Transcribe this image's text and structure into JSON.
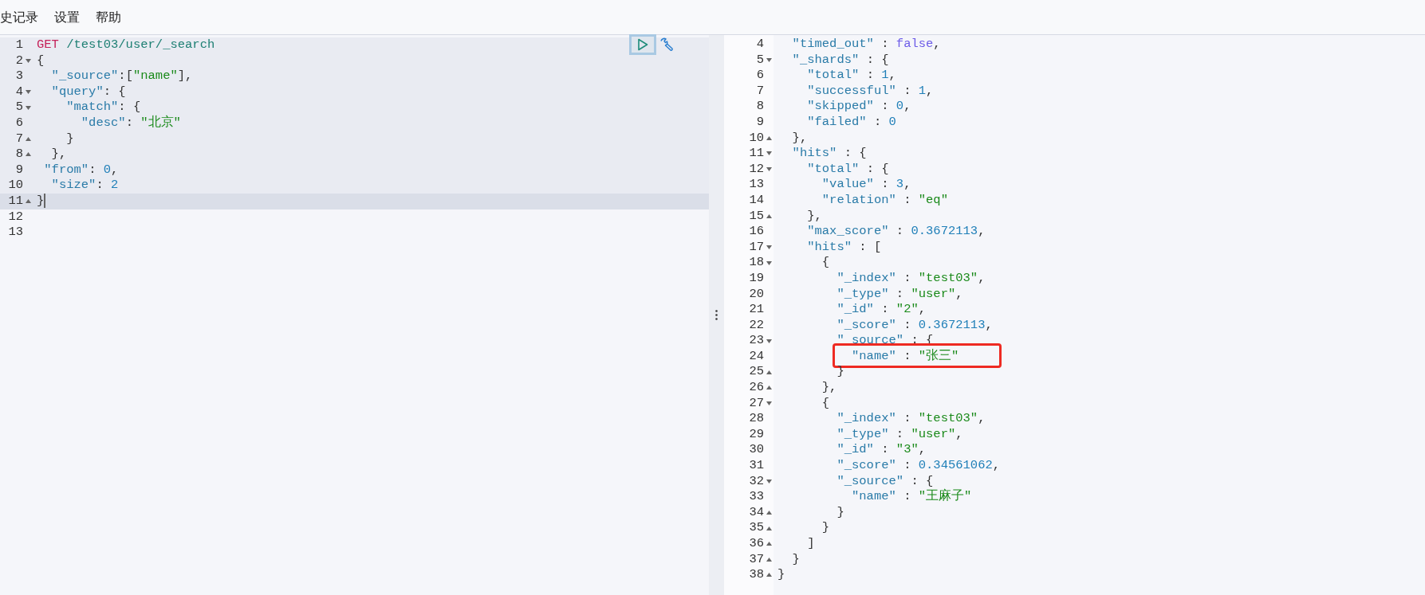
{
  "menu": [
    {
      "label": "史记录"
    },
    {
      "label": "设置"
    },
    {
      "label": "帮助"
    }
  ],
  "request_editor": {
    "lines": [
      {
        "n": "1",
        "kind": "plain",
        "current": false,
        "tokens": [
          {
            "kind": "method",
            "text": "GET"
          },
          {
            "kind": "url",
            "text": " /test03/user/_search"
          }
        ]
      },
      {
        "n": "2",
        "kind": "fold_start",
        "current": false,
        "tokens": [
          {
            "kind": "punct",
            "text": "{"
          }
        ]
      },
      {
        "n": "3",
        "kind": "plain",
        "current": false,
        "tokens": [
          {
            "kind": "key",
            "text": "  \"_source\""
          },
          {
            "kind": "punct",
            "text": ":["
          },
          {
            "kind": "string",
            "text": "\"name\""
          },
          {
            "kind": "punct",
            "text": "],"
          }
        ]
      },
      {
        "n": "4",
        "kind": "fold_start",
        "current": false,
        "tokens": [
          {
            "kind": "key",
            "text": "  \"query\""
          },
          {
            "kind": "punct",
            "text": ": {"
          }
        ]
      },
      {
        "n": "5",
        "kind": "fold_start",
        "current": false,
        "tokens": [
          {
            "kind": "key",
            "text": "    \"match\""
          },
          {
            "kind": "punct",
            "text": ": {"
          }
        ]
      },
      {
        "n": "6",
        "kind": "plain",
        "current": false,
        "tokens": [
          {
            "kind": "key",
            "text": "      \"desc\""
          },
          {
            "kind": "punct",
            "text": ": "
          },
          {
            "kind": "string",
            "text": "\"北京\""
          }
        ]
      },
      {
        "n": "7",
        "kind": "fold_end",
        "current": false,
        "tokens": [
          {
            "kind": "punct",
            "text": "    }"
          }
        ]
      },
      {
        "n": "8",
        "kind": "fold_end",
        "current": false,
        "tokens": [
          {
            "kind": "punct",
            "text": "  },"
          }
        ]
      },
      {
        "n": "9",
        "kind": "plain",
        "current": false,
        "tokens": [
          {
            "kind": "key",
            "text": " \"from\""
          },
          {
            "kind": "punct",
            "text": ": "
          },
          {
            "kind": "number",
            "text": "0"
          },
          {
            "kind": "punct",
            "text": ","
          }
        ]
      },
      {
        "n": "10",
        "kind": "plain",
        "current": false,
        "tokens": [
          {
            "kind": "key",
            "text": "  \"size\""
          },
          {
            "kind": "punct",
            "text": ": "
          },
          {
            "kind": "number",
            "text": "2"
          }
        ]
      },
      {
        "n": "11",
        "kind": "fold_end",
        "current": true,
        "tokens": [
          {
            "kind": "punct",
            "text": "}"
          }
        ]
      },
      {
        "n": "12",
        "kind": "plain",
        "current": false
      },
      {
        "n": "13",
        "kind": "plain",
        "current": false
      }
    ]
  },
  "response_editor": {
    "lines": [
      {
        "n": "4",
        "kind": "plain",
        "annotated": false,
        "tokens": [
          {
            "kind": "key",
            "text": "  \"timed_out\""
          },
          {
            "kind": "punct",
            "text": " : "
          },
          {
            "kind": "boolean",
            "text": "false"
          },
          {
            "kind": "punct",
            "text": ","
          }
        ]
      },
      {
        "n": "5",
        "kind": "fold_start",
        "annotated": false,
        "tokens": [
          {
            "kind": "key",
            "text": "  \"_shards\""
          },
          {
            "kind": "punct",
            "text": " : {"
          }
        ]
      },
      {
        "n": "6",
        "kind": "plain",
        "annotated": false,
        "tokens": [
          {
            "kind": "key",
            "text": "    \"total\""
          },
          {
            "kind": "punct",
            "text": " : "
          },
          {
            "kind": "number",
            "text": "1"
          },
          {
            "kind": "punct",
            "text": ","
          }
        ]
      },
      {
        "n": "7",
        "kind": "plain",
        "annotated": false,
        "tokens": [
          {
            "kind": "key",
            "text": "    \"successful\""
          },
          {
            "kind": "punct",
            "text": " : "
          },
          {
            "kind": "number",
            "text": "1"
          },
          {
            "kind": "punct",
            "text": ","
          }
        ]
      },
      {
        "n": "8",
        "kind": "plain",
        "annotated": false,
        "tokens": [
          {
            "kind": "key",
            "text": "    \"skipped\""
          },
          {
            "kind": "punct",
            "text": " : "
          },
          {
            "kind": "number",
            "text": "0"
          },
          {
            "kind": "punct",
            "text": ","
          }
        ]
      },
      {
        "n": "9",
        "kind": "plain",
        "annotated": false,
        "tokens": [
          {
            "kind": "key",
            "text": "    \"failed\""
          },
          {
            "kind": "punct",
            "text": " : "
          },
          {
            "kind": "number",
            "text": "0"
          }
        ]
      },
      {
        "n": "10",
        "kind": "fold_end",
        "annotated": false,
        "tokens": [
          {
            "kind": "punct",
            "text": "  },"
          }
        ]
      },
      {
        "n": "11",
        "kind": "fold_start",
        "annotated": false,
        "tokens": [
          {
            "kind": "key",
            "text": "  \"hits\""
          },
          {
            "kind": "punct",
            "text": " : {"
          }
        ]
      },
      {
        "n": "12",
        "kind": "fold_start",
        "annotated": false,
        "tokens": [
          {
            "kind": "key",
            "text": "    \"total\""
          },
          {
            "kind": "punct",
            "text": " : {"
          }
        ]
      },
      {
        "n": "13",
        "kind": "plain",
        "annotated": false,
        "tokens": [
          {
            "kind": "key",
            "text": "      \"value\""
          },
          {
            "kind": "punct",
            "text": " : "
          },
          {
            "kind": "number",
            "text": "3"
          },
          {
            "kind": "punct",
            "text": ","
          }
        ]
      },
      {
        "n": "14",
        "kind": "plain",
        "annotated": false,
        "tokens": [
          {
            "kind": "key",
            "text": "      \"relation\""
          },
          {
            "kind": "punct",
            "text": " : "
          },
          {
            "kind": "string",
            "text": "\"eq\""
          }
        ]
      },
      {
        "n": "15",
        "kind": "fold_end",
        "annotated": false,
        "tokens": [
          {
            "kind": "punct",
            "text": "    },"
          }
        ]
      },
      {
        "n": "16",
        "kind": "plain",
        "annotated": false,
        "tokens": [
          {
            "kind": "key",
            "text": "    \"max_score\""
          },
          {
            "kind": "punct",
            "text": " : "
          },
          {
            "kind": "number",
            "text": "0.3672113"
          },
          {
            "kind": "punct",
            "text": ","
          }
        ]
      },
      {
        "n": "17",
        "kind": "fold_start",
        "annotated": false,
        "tokens": [
          {
            "kind": "key",
            "text": "    \"hits\""
          },
          {
            "kind": "punct",
            "text": " : ["
          }
        ]
      },
      {
        "n": "18",
        "kind": "fold_start",
        "annotated": false,
        "tokens": [
          {
            "kind": "punct",
            "text": "      {"
          }
        ]
      },
      {
        "n": "19",
        "kind": "plain",
        "annotated": false,
        "tokens": [
          {
            "kind": "key",
            "text": "        \"_index\""
          },
          {
            "kind": "punct",
            "text": " : "
          },
          {
            "kind": "string",
            "text": "\"test03\""
          },
          {
            "kind": "punct",
            "text": ","
          }
        ]
      },
      {
        "n": "20",
        "kind": "plain",
        "annotated": false,
        "tokens": [
          {
            "kind": "key",
            "text": "        \"_type\""
          },
          {
            "kind": "punct",
            "text": " : "
          },
          {
            "kind": "string",
            "text": "\"user\""
          },
          {
            "kind": "punct",
            "text": ","
          }
        ]
      },
      {
        "n": "21",
        "kind": "plain",
        "annotated": false,
        "tokens": [
          {
            "kind": "key",
            "text": "        \"_id\""
          },
          {
            "kind": "punct",
            "text": " : "
          },
          {
            "kind": "string",
            "text": "\"2\""
          },
          {
            "kind": "punct",
            "text": ","
          }
        ]
      },
      {
        "n": "22",
        "kind": "plain",
        "annotated": false,
        "tokens": [
          {
            "kind": "key",
            "text": "        \"_score\""
          },
          {
            "kind": "punct",
            "text": " : "
          },
          {
            "kind": "number",
            "text": "0.3672113"
          },
          {
            "kind": "punct",
            "text": ","
          }
        ]
      },
      {
        "n": "23",
        "kind": "fold_start",
        "annotated": false,
        "tokens": [
          {
            "kind": "key",
            "text": "        \"_source\""
          },
          {
            "kind": "punct",
            "text": " : {"
          }
        ]
      },
      {
        "n": "24",
        "kind": "plain",
        "annotated": true,
        "tokens": [
          {
            "kind": "key",
            "text": "          \"name\""
          },
          {
            "kind": "punct",
            "text": " : "
          },
          {
            "kind": "string",
            "text": "\"张三\""
          }
        ]
      },
      {
        "n": "25",
        "kind": "fold_end",
        "annotated": false,
        "tokens": [
          {
            "kind": "punct",
            "text": "        }"
          }
        ]
      },
      {
        "n": "26",
        "kind": "fold_end",
        "annotated": false,
        "tokens": [
          {
            "kind": "punct",
            "text": "      },"
          }
        ]
      },
      {
        "n": "27",
        "kind": "fold_start",
        "annotated": false,
        "tokens": [
          {
            "kind": "punct",
            "text": "      {"
          }
        ]
      },
      {
        "n": "28",
        "kind": "plain",
        "annotated": false,
        "tokens": [
          {
            "kind": "key",
            "text": "        \"_index\""
          },
          {
            "kind": "punct",
            "text": " : "
          },
          {
            "kind": "string",
            "text": "\"test03\""
          },
          {
            "kind": "punct",
            "text": ","
          }
        ]
      },
      {
        "n": "29",
        "kind": "plain",
        "annotated": false,
        "tokens": [
          {
            "kind": "key",
            "text": "        \"_type\""
          },
          {
            "kind": "punct",
            "text": " : "
          },
          {
            "kind": "string",
            "text": "\"user\""
          },
          {
            "kind": "punct",
            "text": ","
          }
        ]
      },
      {
        "n": "30",
        "kind": "plain",
        "annotated": false,
        "tokens": [
          {
            "kind": "key",
            "text": "        \"_id\""
          },
          {
            "kind": "punct",
            "text": " : "
          },
          {
            "kind": "string",
            "text": "\"3\""
          },
          {
            "kind": "punct",
            "text": ","
          }
        ]
      },
      {
        "n": "31",
        "kind": "plain",
        "annotated": false,
        "tokens": [
          {
            "kind": "key",
            "text": "        \"_score\""
          },
          {
            "kind": "punct",
            "text": " : "
          },
          {
            "kind": "number",
            "text": "0.34561062"
          },
          {
            "kind": "punct",
            "text": ","
          }
        ]
      },
      {
        "n": "32",
        "kind": "fold_start",
        "annotated": false,
        "tokens": [
          {
            "kind": "key",
            "text": "        \"_source\""
          },
          {
            "kind": "punct",
            "text": " : {"
          }
        ]
      },
      {
        "n": "33",
        "kind": "plain",
        "annotated": false,
        "tokens": [
          {
            "kind": "key",
            "text": "          \"name\""
          },
          {
            "kind": "punct",
            "text": " : "
          },
          {
            "kind": "string",
            "text": "\"王麻子\""
          }
        ]
      },
      {
        "n": "34",
        "kind": "fold_end",
        "annotated": false,
        "tokens": [
          {
            "kind": "punct",
            "text": "        }"
          }
        ]
      },
      {
        "n": "35",
        "kind": "fold_end",
        "annotated": false,
        "tokens": [
          {
            "kind": "punct",
            "text": "      }"
          }
        ]
      },
      {
        "n": "36",
        "kind": "fold_end",
        "annotated": false,
        "tokens": [
          {
            "kind": "punct",
            "text": "    ]"
          }
        ]
      },
      {
        "n": "37",
        "kind": "fold_end",
        "annotated": false,
        "tokens": [
          {
            "kind": "punct",
            "text": "  }"
          }
        ]
      },
      {
        "n": "38",
        "kind": "fold_end",
        "annotated": false,
        "tokens": [
          {
            "kind": "punct",
            "text": "}"
          }
        ]
      }
    ]
  }
}
